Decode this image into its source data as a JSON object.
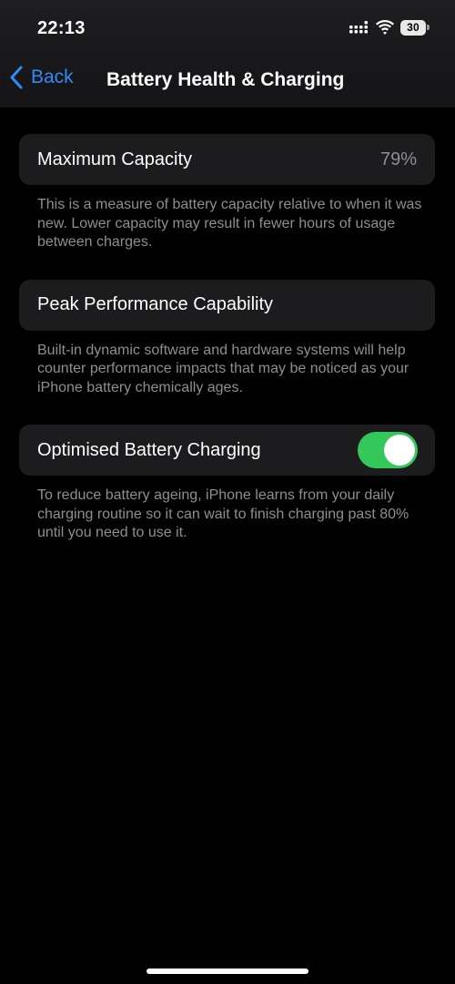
{
  "status_bar": {
    "time": "22:13",
    "battery_level": "30",
    "signal_icon": "signal-bars-icon",
    "wifi_icon": "wifi-icon",
    "battery_icon": "battery-icon"
  },
  "nav": {
    "back_label": "Back",
    "back_icon": "chevron-left-icon",
    "title": "Battery Health & Charging"
  },
  "sections": {
    "capacity": {
      "label": "Maximum Capacity",
      "value": "79%",
      "footnote": "This is a measure of battery capacity relative to when it was new. Lower capacity may result in fewer hours of usage between charges."
    },
    "performance": {
      "label": "Peak Performance Capability",
      "footnote": "Built-in dynamic software and hardware systems will help counter performance impacts that may be noticed as your iPhone battery chemically ages."
    },
    "optimised": {
      "label": "Optimised Battery Charging",
      "toggle_on": true,
      "footnote": "To reduce battery ageing, iPhone learns from your daily charging routine so it can wait to finish charging past 80% until you need to use it."
    }
  },
  "colors": {
    "accent": "#2f8cf6",
    "toggle_on": "#34c759",
    "card_bg": "#1c1c1e",
    "secondary_text": "#8e8e93"
  }
}
